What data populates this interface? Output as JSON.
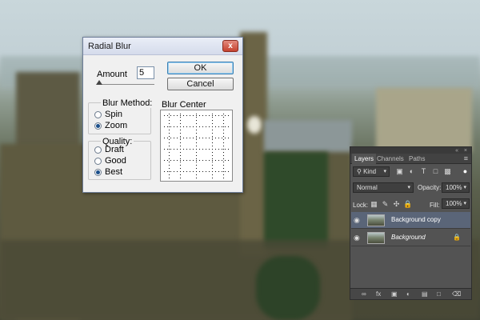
{
  "dialog": {
    "title": "Radial Blur",
    "close_glyph": "x",
    "amount_label": "Amount",
    "amount_value": "5",
    "ok_label": "OK",
    "cancel_label": "Cancel",
    "blur_method": {
      "legend": "Blur Method:",
      "options": [
        "Spin",
        "Zoom"
      ],
      "selected": "Zoom"
    },
    "quality": {
      "legend": "Quality:",
      "options": [
        "Draft",
        "Good",
        "Best"
      ],
      "selected": "Best"
    },
    "blur_center_label": "Blur Center"
  },
  "layers_panel": {
    "tabs": [
      "Layers",
      "Channels",
      "Paths"
    ],
    "active_tab": "Layers",
    "filter_kind": "Kind",
    "blend_mode": "Normal",
    "opacity_label": "Opacity:",
    "opacity_value": "100%",
    "lock_label": "Lock:",
    "fill_label": "Fill:",
    "fill_value": "100%",
    "layers": [
      {
        "name": "Background copy",
        "selected": true,
        "italic": false,
        "locked": false
      },
      {
        "name": "Background",
        "selected": false,
        "italic": true,
        "locked": true
      }
    ],
    "footer_icons": [
      "link-icon",
      "fx-icon",
      "mask-icon",
      "adjustment-icon",
      "folder-icon",
      "new-layer-icon",
      "trash-icon"
    ]
  }
}
